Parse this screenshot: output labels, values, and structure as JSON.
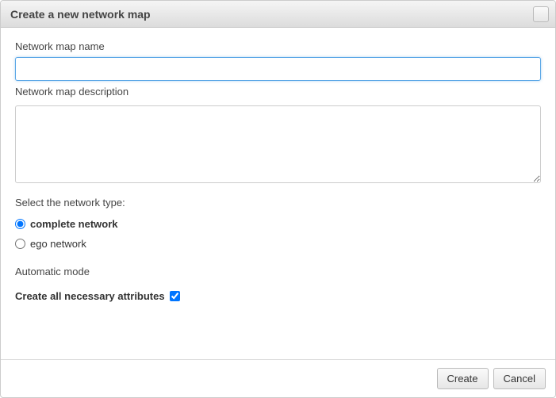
{
  "dialog": {
    "title": "Create a new network map"
  },
  "fields": {
    "name_label": "Network map name",
    "name_value": "",
    "desc_label": "Network map description",
    "desc_value": ""
  },
  "network_type": {
    "label": "Select the network type:",
    "options": {
      "complete": "complete network",
      "ego": "ego network"
    },
    "selected": "complete"
  },
  "automatic": {
    "label": "Automatic mode",
    "checkbox_label": "Create all necessary attributes",
    "checked": true
  },
  "buttons": {
    "create": "Create",
    "cancel": "Cancel"
  }
}
